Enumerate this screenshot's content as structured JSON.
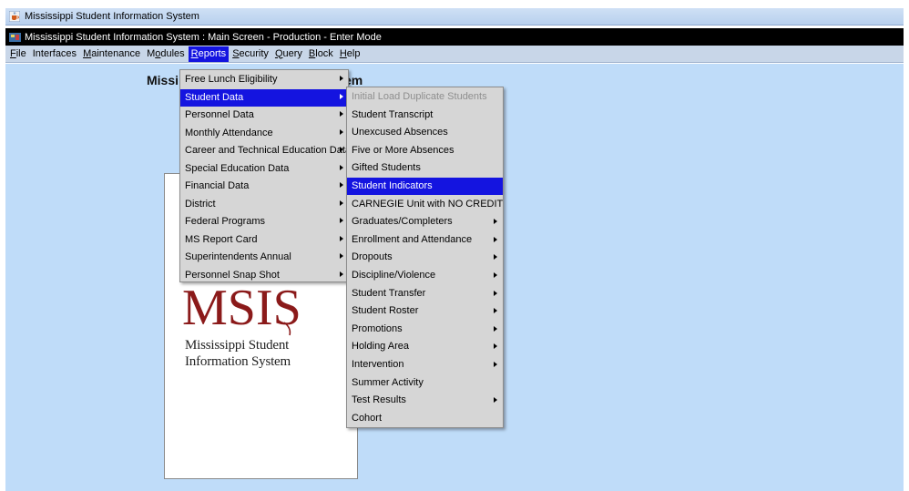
{
  "outer_window": {
    "title": "Mississippi Student Information System",
    "icon": "java-cup-icon"
  },
  "inner_window": {
    "title": "Mississippi Student Information System : Main Screen  -  Production  -  Enter Mode",
    "icon": "oracle-forms-icon"
  },
  "menubar": {
    "items": [
      {
        "label": "File",
        "ul": "F",
        "rest": "ile"
      },
      {
        "label": "Interfaces",
        "ul": "",
        "rest": "Interfaces"
      },
      {
        "label": "Maintenance",
        "ul": "M",
        "rest": "aintenance"
      },
      {
        "label": "Modules",
        "pre": "M",
        "ul": "o",
        "rest": "dules"
      },
      {
        "label": "Reports",
        "ul": "R",
        "rest": "eports"
      },
      {
        "label": "Security",
        "ul": "S",
        "rest": "ecurity"
      },
      {
        "label": "Query",
        "ul": "Q",
        "rest": "uery"
      },
      {
        "label": "Block",
        "ul": "B",
        "rest": "lock"
      },
      {
        "label": "Help",
        "ul": "H",
        "rest": "elp"
      }
    ]
  },
  "background": {
    "heading_left": "Missi",
    "heading_right": "em"
  },
  "logo": {
    "wordmark": "MSIS",
    "line1": "Mississippi Student",
    "line2": "Information System"
  },
  "reports_menu": {
    "items": [
      {
        "label": "Free Lunch Eligibility",
        "submenu": true
      },
      {
        "label": "Student Data",
        "submenu": true,
        "highlighted": true
      },
      {
        "label": "Personnel Data",
        "submenu": true
      },
      {
        "label": "Monthly Attendance",
        "submenu": true
      },
      {
        "label": "Career and Technical Education Data",
        "submenu": true
      },
      {
        "label": "Special Education Data",
        "submenu": true
      },
      {
        "label": "Financial Data",
        "submenu": true
      },
      {
        "label": "District",
        "submenu": true
      },
      {
        "label": "Federal Programs",
        "submenu": true
      },
      {
        "label": "MS Report Card",
        "submenu": true
      },
      {
        "label": "Superintendents Annual",
        "submenu": true
      },
      {
        "label": "Personnel Snap Shot",
        "submenu": true
      }
    ]
  },
  "student_data_menu": {
    "items": [
      {
        "label": "Initial Load Duplicate Students",
        "disabled": true
      },
      {
        "label": "Student Transcript"
      },
      {
        "label": "Unexcused Absences"
      },
      {
        "label": "Five or More Absences"
      },
      {
        "label": "Gifted Students"
      },
      {
        "label": "Student Indicators",
        "highlighted": true
      },
      {
        "label": "CARNEGIE Unit with NO CREDIT"
      },
      {
        "label": "Graduates/Completers",
        "submenu": true
      },
      {
        "label": "Enrollment and Attendance",
        "submenu": true
      },
      {
        "label": "Dropouts",
        "submenu": true
      },
      {
        "label": "Discipline/Violence",
        "submenu": true
      },
      {
        "label": "Student Transfer",
        "submenu": true
      },
      {
        "label": "Student Roster",
        "submenu": true
      },
      {
        "label": "Promotions",
        "submenu": true
      },
      {
        "label": "Holding Area",
        "submenu": true
      },
      {
        "label": "Intervention",
        "submenu": true
      },
      {
        "label": "Summer Activity"
      },
      {
        "label": "Test Results",
        "submenu": true
      },
      {
        "label": "Cohort"
      }
    ]
  },
  "colors": {
    "highlight": "#1414e0",
    "workspace": "#bfdcf9",
    "menu_bg": "#d6d6d6",
    "logo_red": "#8b1a1a"
  }
}
